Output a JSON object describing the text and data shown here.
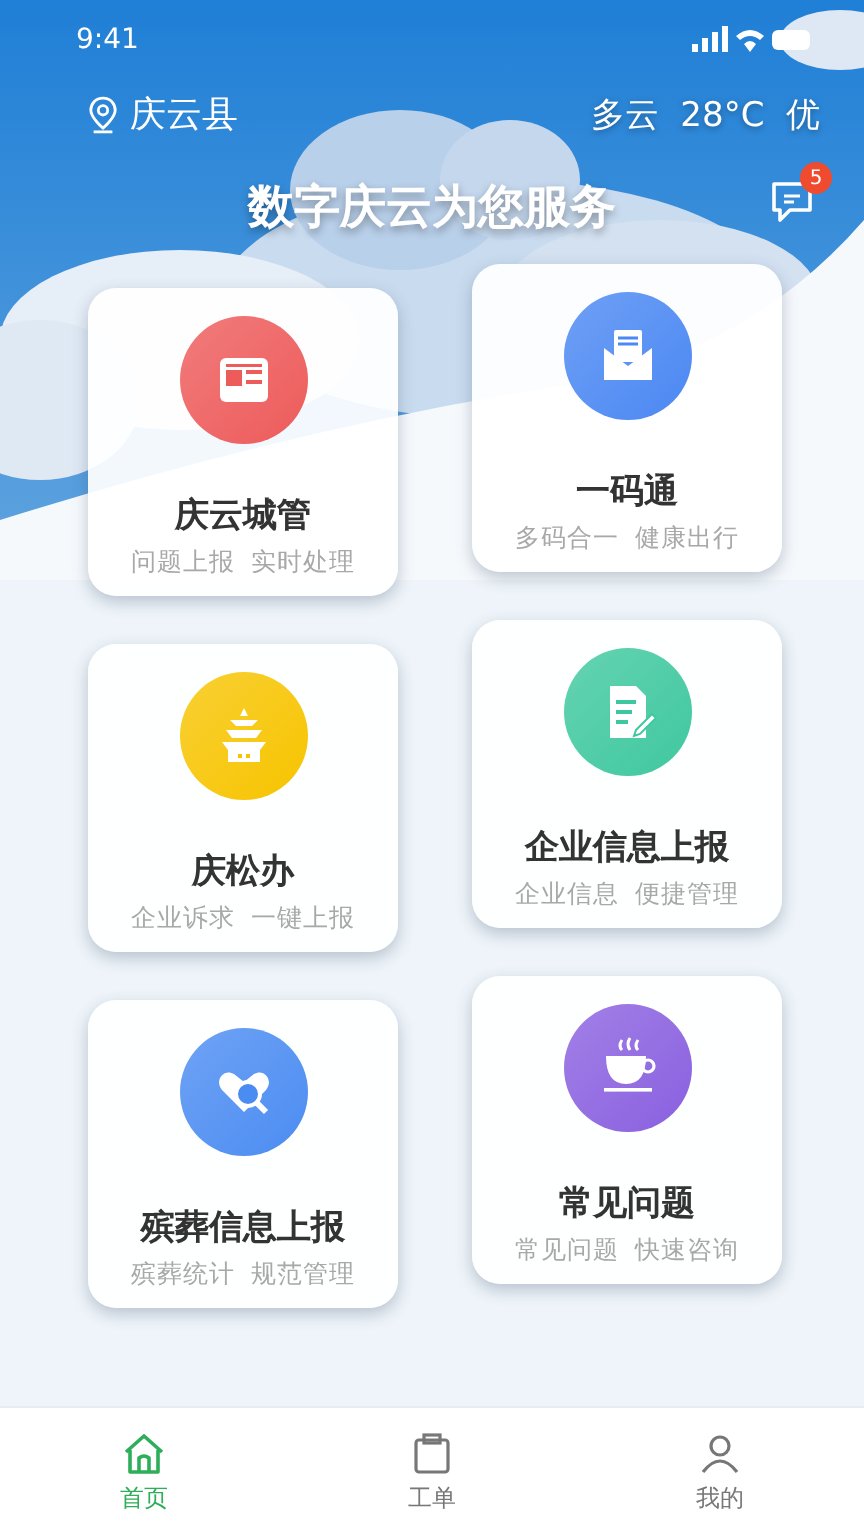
{
  "status_bar": {
    "time": "9:41"
  },
  "header": {
    "location": "庆云县",
    "weather": "多云  28°C  优"
  },
  "title": "数字庆云为您服务",
  "messages": {
    "badge": "5"
  },
  "services": [
    {
      "title": "庆云城管",
      "subtitle": "问题上报  实时处理",
      "color": "#ee5b5b"
    },
    {
      "title": "一码通",
      "subtitle": "多码合一  健康出行",
      "color": "#4b88f3"
    },
    {
      "title": "庆松办",
      "subtitle": "企业诉求  一键上报",
      "color": "#f7c400"
    },
    {
      "title": "企业信息上报",
      "subtitle": "企业信息  便捷管理",
      "color": "#3fc89f"
    },
    {
      "title": "殡葬信息上报",
      "subtitle": "殡葬统计  规范管理",
      "color": "#4b8cf2"
    },
    {
      "title": "常见问题",
      "subtitle": "常见问题  快速咨询",
      "color": "#8a60e0"
    }
  ],
  "tabs": [
    {
      "label": "首页",
      "selected": true
    },
    {
      "label": "工单",
      "selected": false
    },
    {
      "label": "我的",
      "selected": false
    }
  ]
}
